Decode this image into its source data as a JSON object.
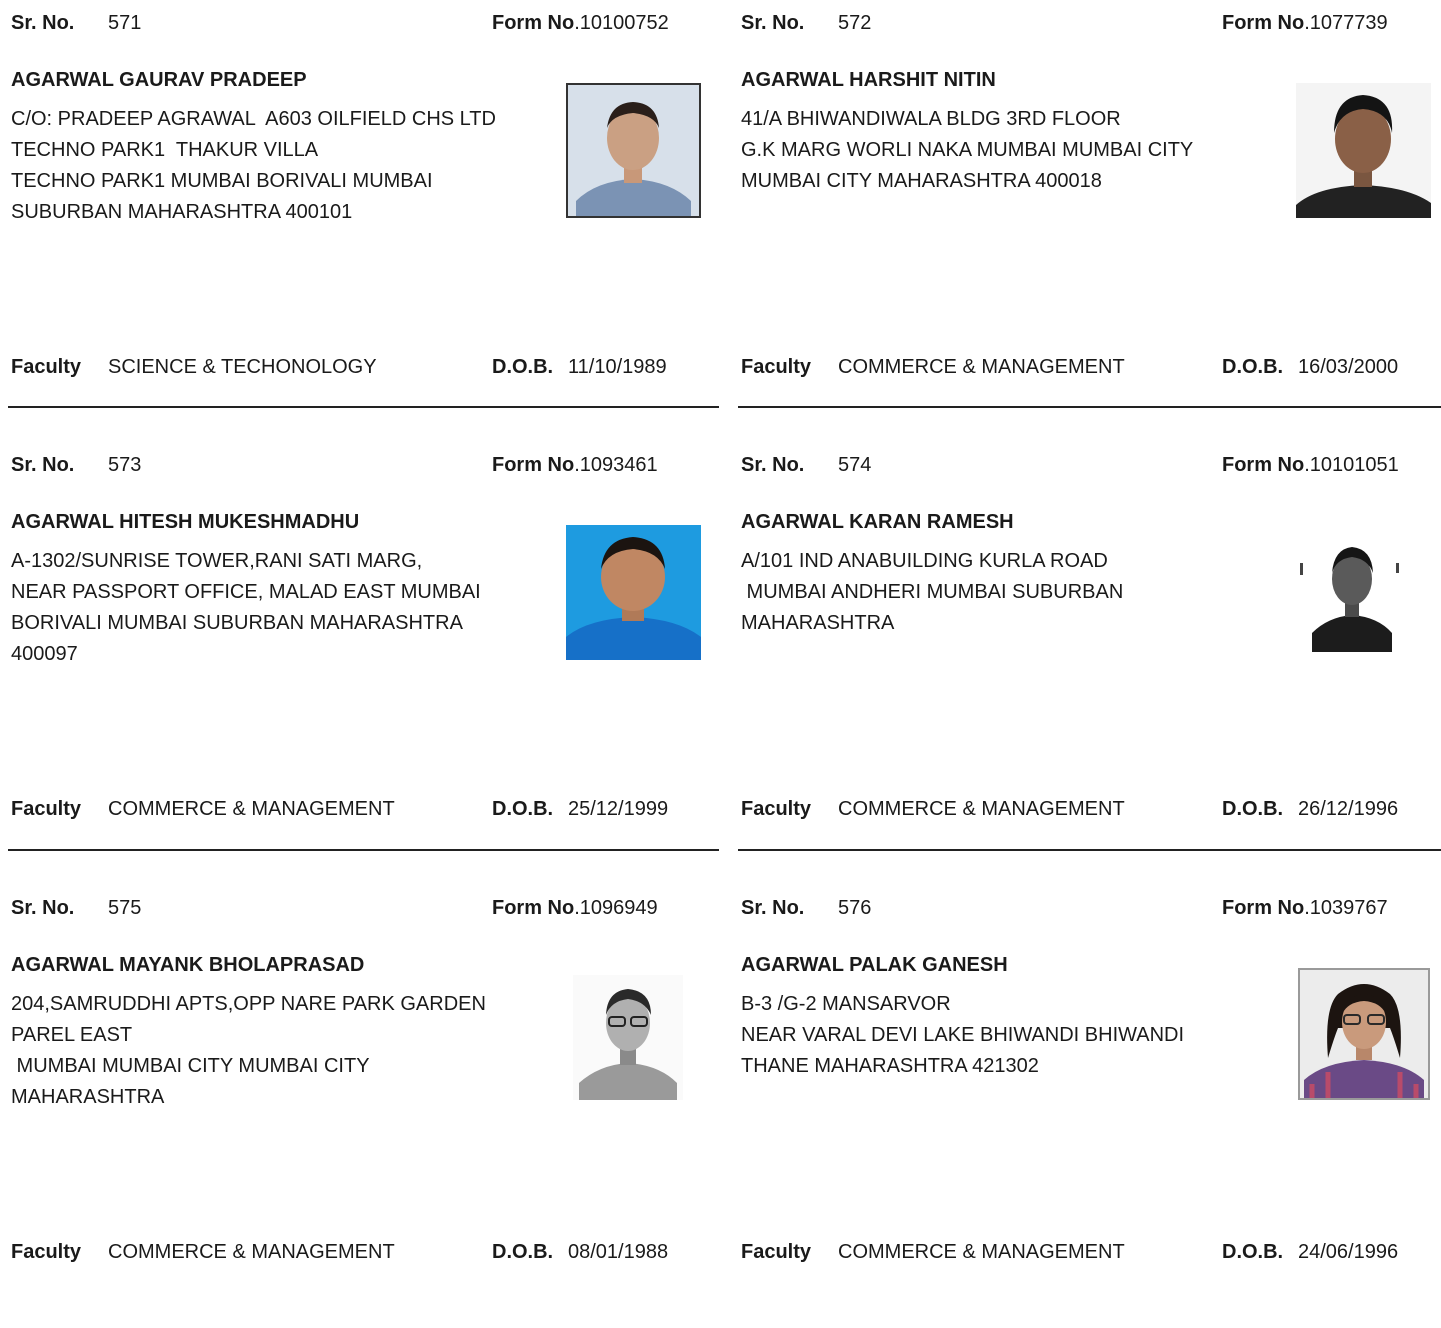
{
  "labels": {
    "sr_no": "Sr. No.",
    "form_no": "Form No",
    "faculty": "Faculty",
    "dob": "D.O.B."
  },
  "records": [
    {
      "sr_no": "571",
      "form_no": ".10100752",
      "name": "AGARWAL GAURAV PRADEEP",
      "address_lines": [
        "C/O: PRADEEP AGRAWAL  A603 OILFIELD CHS LTD",
        "TECHNO PARK1  THAKUR VILLA",
        "TECHNO PARK1 MUMBAI BORIVALI MUMBAI",
        "SUBURBAN MAHARASHTRA 400101"
      ],
      "faculty": "SCIENCE & TECHONOLOGY",
      "dob": "11/10/1989"
    },
    {
      "sr_no": "572",
      "form_no": ".1077739",
      "name": "AGARWAL HARSHIT NITIN",
      "address_lines": [
        "41/A BHIWANDIWALA BLDG 3RD FLOOR",
        "G.K MARG WORLI NAKA MUMBAI MUMBAI CITY",
        "MUMBAI CITY MAHARASHTRA 400018"
      ],
      "faculty": "COMMERCE & MANAGEMENT",
      "dob": "16/03/2000"
    },
    {
      "sr_no": "573",
      "form_no": ".1093461",
      "name": "AGARWAL HITESH MUKESHMADHU",
      "address_lines": [
        "A-1302/SUNRISE TOWER,RANI SATI MARG,",
        "NEAR PASSPORT OFFICE, MALAD EAST MUMBAI",
        "BORIVALI MUMBAI SUBURBAN MAHARASHTRA",
        "400097"
      ],
      "faculty": "COMMERCE & MANAGEMENT",
      "dob": "25/12/1999"
    },
    {
      "sr_no": "574",
      "form_no": ".10101051",
      "name": "AGARWAL KARAN RAMESH",
      "address_lines": [
        "A/101 IND ANABUILDING KURLA ROAD",
        " MUMBAI ANDHERI MUMBAI SUBURBAN",
        "MAHARASHTRA"
      ],
      "faculty": "COMMERCE & MANAGEMENT",
      "dob": "26/12/1996"
    },
    {
      "sr_no": "575",
      "form_no": ".1096949",
      "name": "AGARWAL MAYANK BHOLAPRASAD",
      "address_lines": [
        "204,SAMRUDDHI APTS,OPP NARE PARK GARDEN",
        "PAREL EAST",
        " MUMBAI MUMBAI CITY MUMBAI CITY",
        "MAHARASHTRA"
      ],
      "faculty": "COMMERCE & MANAGEMENT",
      "dob": "08/01/1988"
    },
    {
      "sr_no": "576",
      "form_no": ".1039767",
      "name": "AGARWAL PALAK GANESH",
      "address_lines": [
        "B-3 /G-2 MANSARVOR",
        "NEAR VARAL DEVI LAKE BHIWANDI BHIWANDI",
        "THANE MAHARASHTRA 421302"
      ],
      "faculty": "COMMERCE & MANAGEMENT",
      "dob": "24/06/1996"
    }
  ]
}
